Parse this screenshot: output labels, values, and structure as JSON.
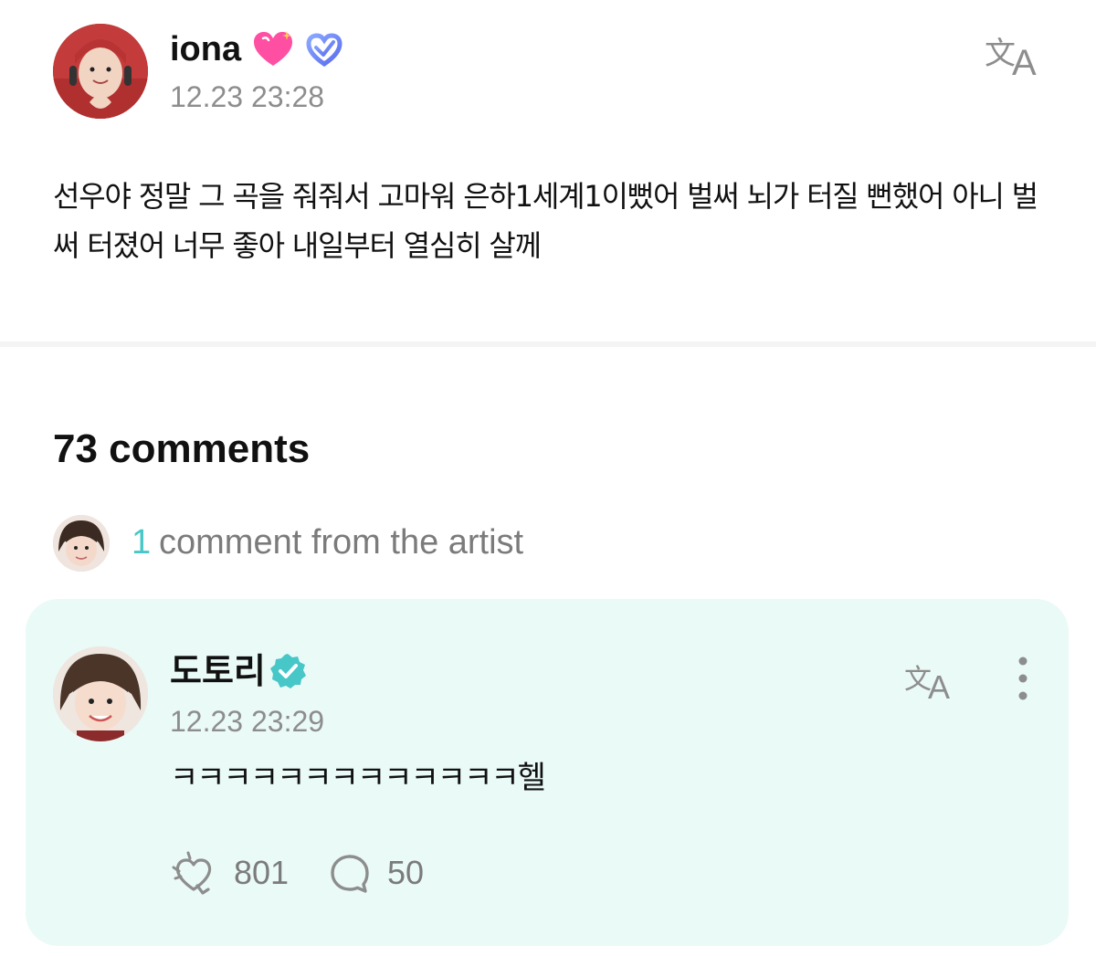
{
  "post": {
    "author": "iona",
    "author_icons": [
      "sparkling-heart-icon",
      "fan-membership-badge-icon"
    ],
    "timestamp": "12.23 23:28",
    "body": "선우야 정말 그 곡을 줘줘서 고마워 은하1세계1이뻤어 벌써 뇌가 터질 뻔했어 아니 벌써 터졌어 너무 좋아 내일부터 열심히 살께",
    "translate_icon": "translate-icon"
  },
  "comments": {
    "count_label": "73 comments",
    "artist_summary": {
      "count": "1",
      "label": "comment from the artist"
    },
    "artist_comment": {
      "author": "도토리",
      "verified_icon": "verified-badge-icon",
      "timestamp": "12.23 23:29",
      "body": "ㅋㅋㅋㅋㅋㅋㅋㅋㅋㅋㅋㅋㅋ헬",
      "likes": "801",
      "replies": "50",
      "like_icon": "like-icon",
      "reply_icon": "reply-bubble-icon",
      "more_icon": "more-vertical-icon"
    }
  },
  "colors": {
    "accent_teal": "#47c7c7",
    "card_background": "#eafaf7",
    "muted_text": "#8d8d8d",
    "secondary_text": "#7b7b7b",
    "heart_pink": "#ff4fa3",
    "fan_badge_blue": "#6a8cff"
  }
}
